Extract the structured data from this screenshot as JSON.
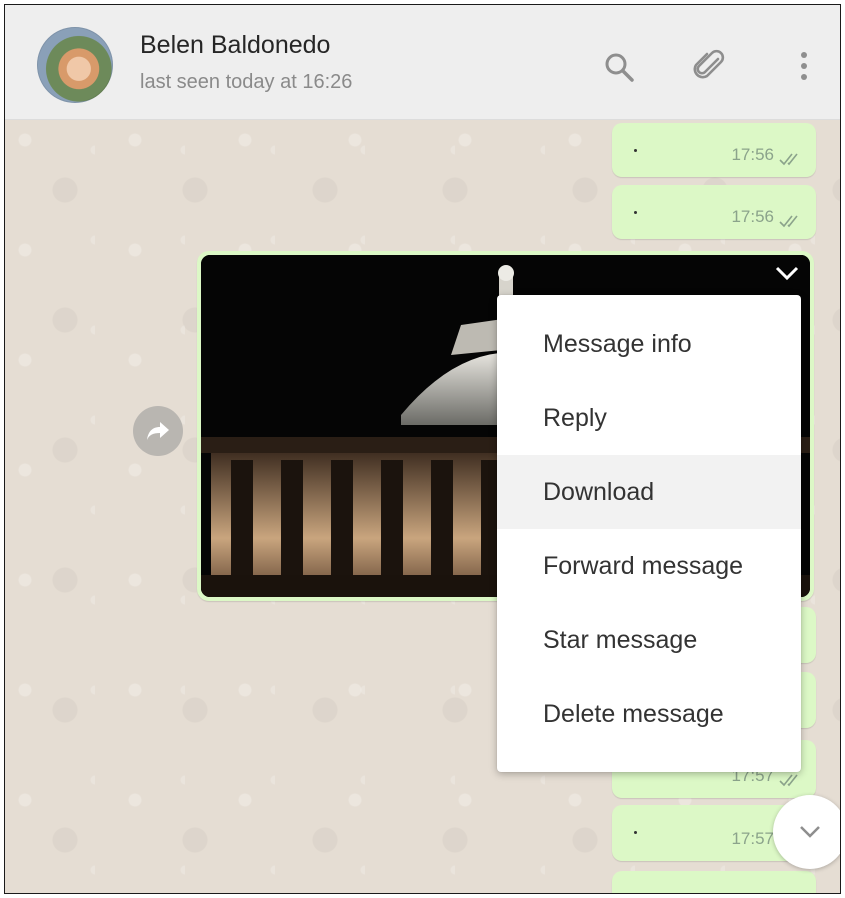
{
  "header": {
    "name": "Belen Baldonedo",
    "status": "last seen today at 16:26",
    "icons": [
      "search-icon",
      "attach-icon",
      "menu-icon"
    ]
  },
  "messages": [
    {
      "text": "·",
      "time": "17:56",
      "status": "read"
    },
    {
      "text": "·",
      "time": "17:56",
      "status": "read"
    },
    {
      "text": "·",
      "time": "17:57",
      "status": "read"
    },
    {
      "text": "·",
      "time": "17:57",
      "status": "read"
    }
  ],
  "context_menu": {
    "items": [
      "Message info",
      "Reply",
      "Download",
      "Forward message",
      "Star message",
      "Delete message"
    ],
    "highlighted": "Download"
  },
  "colors": {
    "header_bg": "#eeeeee",
    "chat_bg": "#e5ddd3",
    "outgoing_bubble": "#dcf8c6",
    "read_ticks": "#8ba38b"
  }
}
